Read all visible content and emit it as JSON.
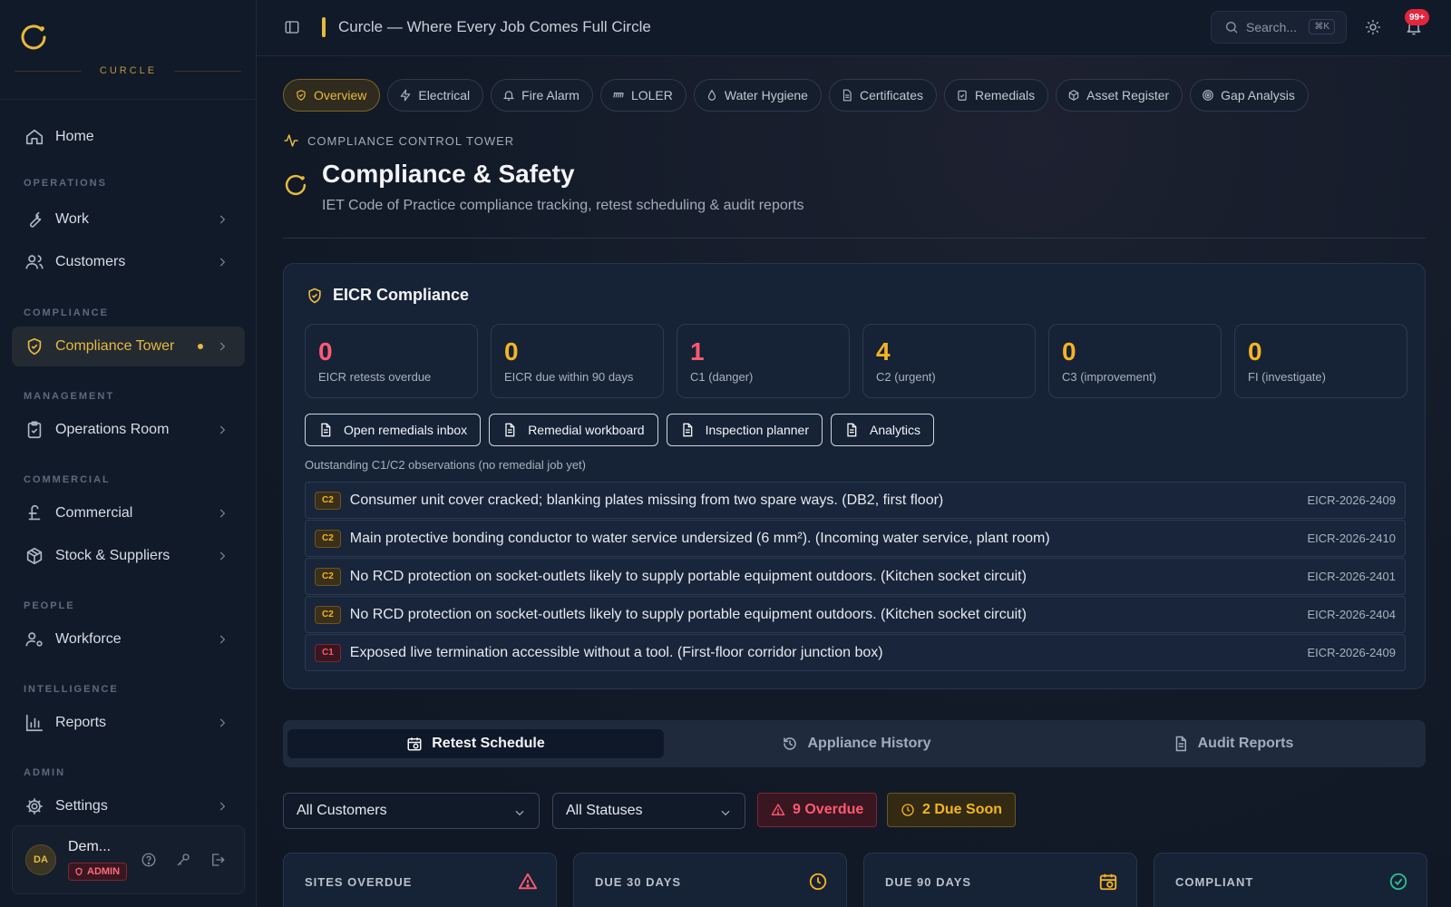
{
  "brand": {
    "name": "CURCLE",
    "accent": "#e7b93f"
  },
  "sidebar": {
    "home": "Home",
    "sections": {
      "operations": "OPERATIONS",
      "compliance": "COMPLIANCE",
      "management": "MANAGEMENT",
      "commercial": "COMMERCIAL",
      "people": "PEOPLE",
      "intelligence": "INTELLIGENCE",
      "admin": "ADMIN"
    },
    "items": {
      "work": "Work",
      "customers": "Customers",
      "compliance_tower": "Compliance Tower",
      "operations_room": "Operations Room",
      "commercial": "Commercial",
      "stock": "Stock & Suppliers",
      "workforce": "Workforce",
      "reports": "Reports",
      "settings": "Settings"
    },
    "user": {
      "initials": "DA",
      "name": "Dem...",
      "role": "ADMIN"
    }
  },
  "topbar": {
    "title": "Curcle — Where Every Job Comes Full Circle",
    "search_placeholder": "Search...",
    "search_shortcut": "⌘K",
    "notification_count": "99+"
  },
  "pills": {
    "overview": "Overview",
    "electrical": "Electrical",
    "fire_alarm": "Fire Alarm",
    "loler": "LOLER",
    "water": "Water Hygiene",
    "certificates": "Certificates",
    "remedials": "Remedials",
    "asset_register": "Asset Register",
    "gap_analysis": "Gap Analysis"
  },
  "header": {
    "eyebrow": "COMPLIANCE CONTROL TOWER",
    "title": "Compliance & Safety",
    "subtitle": "IET Code of Practice compliance tracking, retest scheduling & audit reports"
  },
  "eicr": {
    "title": "EICR Compliance",
    "stats": [
      {
        "value": "0",
        "label": "EICR retests overdue"
      },
      {
        "value": "0",
        "label": "EICR due within 90 days"
      },
      {
        "value": "1",
        "label": "C1 (danger)"
      },
      {
        "value": "4",
        "label": "C2 (urgent)"
      },
      {
        "value": "0",
        "label": "C3 (improvement)"
      },
      {
        "value": "0",
        "label": "FI (investigate)"
      }
    ],
    "actions": {
      "remedials_inbox": "Open remedials inbox",
      "remedial_workboard": "Remedial workboard",
      "inspection_planner": "Inspection planner",
      "analytics": "Analytics"
    },
    "outstanding_label": "Outstanding C1/C2 observations (no remedial job yet)",
    "observations": [
      {
        "code": "C2",
        "text": "Consumer unit cover cracked; blanking plates missing from two spare ways. (DB2, first floor)",
        "ref": "EICR-2026-2409"
      },
      {
        "code": "C2",
        "text": "Main protective bonding conductor to water service undersized (6 mm²). (Incoming water service, plant room)",
        "ref": "EICR-2026-2410"
      },
      {
        "code": "C2",
        "text": "No RCD protection on socket-outlets likely to supply portable equipment outdoors. (Kitchen socket circuit)",
        "ref": "EICR-2026-2401"
      },
      {
        "code": "C2",
        "text": "No RCD protection on socket-outlets likely to supply portable equipment outdoors. (Kitchen socket circuit)",
        "ref": "EICR-2026-2404"
      },
      {
        "code": "C1",
        "text": "Exposed live termination accessible without a tool. (First-floor corridor junction box)",
        "ref": "EICR-2026-2409"
      }
    ]
  },
  "tabs": {
    "retest": "Retest Schedule",
    "history": "Appliance History",
    "audit": "Audit Reports"
  },
  "filters": {
    "customers": "All Customers",
    "statuses": "All Statuses",
    "overdue": "9 Overdue",
    "due_soon": "2 Due Soon"
  },
  "kpis": {
    "sites_overdue": "SITES OVERDUE",
    "due_30": "DUE 30 DAYS",
    "due_90": "DUE 90 DAYS",
    "compliant": "COMPLIANT"
  }
}
